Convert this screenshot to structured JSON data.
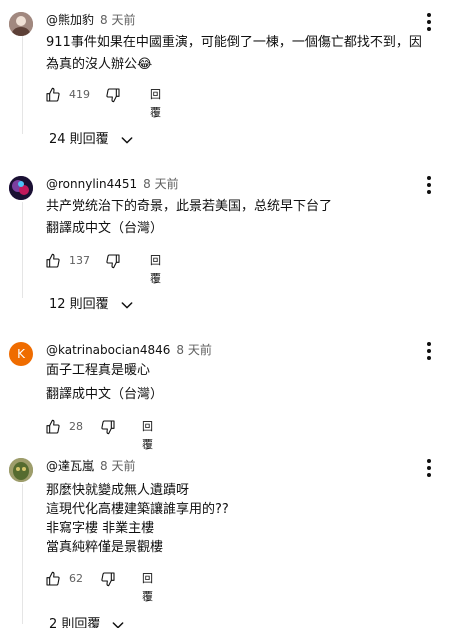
{
  "comments": [
    {
      "author": "@熊加豹",
      "time": "8 天前",
      "lines": [
        "911事件如果在中國重演，可能倒了一棟，一個傷亡都找不到，因",
        "為真的沒人辦公😂"
      ],
      "translate": "",
      "likes": "419",
      "reply_label": "回覆",
      "replies_label": "24 則回覆",
      "avatar_color": "#8d6e63"
    },
    {
      "author": "@ronnylin4451",
      "time": "8 天前",
      "lines": [
        "共产党统治下的奇景，此景若美国，总统早下台了"
      ],
      "translate": "翻譯成中文（台灣）",
      "likes": "137",
      "reply_label": "回覆",
      "replies_label": "12 則回覆",
      "avatar_color": "#3b1f5c"
    },
    {
      "author": "@katrinabocian4846",
      "time": "8 天前",
      "lines": [
        "面子工程真是暖心"
      ],
      "translate": "翻譯成中文（台灣）",
      "likes": "28",
      "reply_label": "回覆",
      "replies_label": "",
      "avatar_color": "#ef6c00",
      "avatar_letter": "K"
    },
    {
      "author": "@達瓦嵐",
      "time": "8 天前",
      "lines": [
        "那麼快就變成無人遺蹟呀",
        "這現代化高樓建築讓誰享用的??",
        "非寫字樓 非業主樓",
        "當真純粹僅是景觀樓"
      ],
      "translate": "",
      "likes": "62",
      "reply_label": "回覆",
      "replies_label": "2 則回覆",
      "avatar_color": "#7a8450"
    }
  ],
  "icons": {
    "like": "thumb-up-icon",
    "dislike": "thumb-down-icon",
    "more": "more-vert-icon",
    "expand": "chevron-down-icon"
  }
}
